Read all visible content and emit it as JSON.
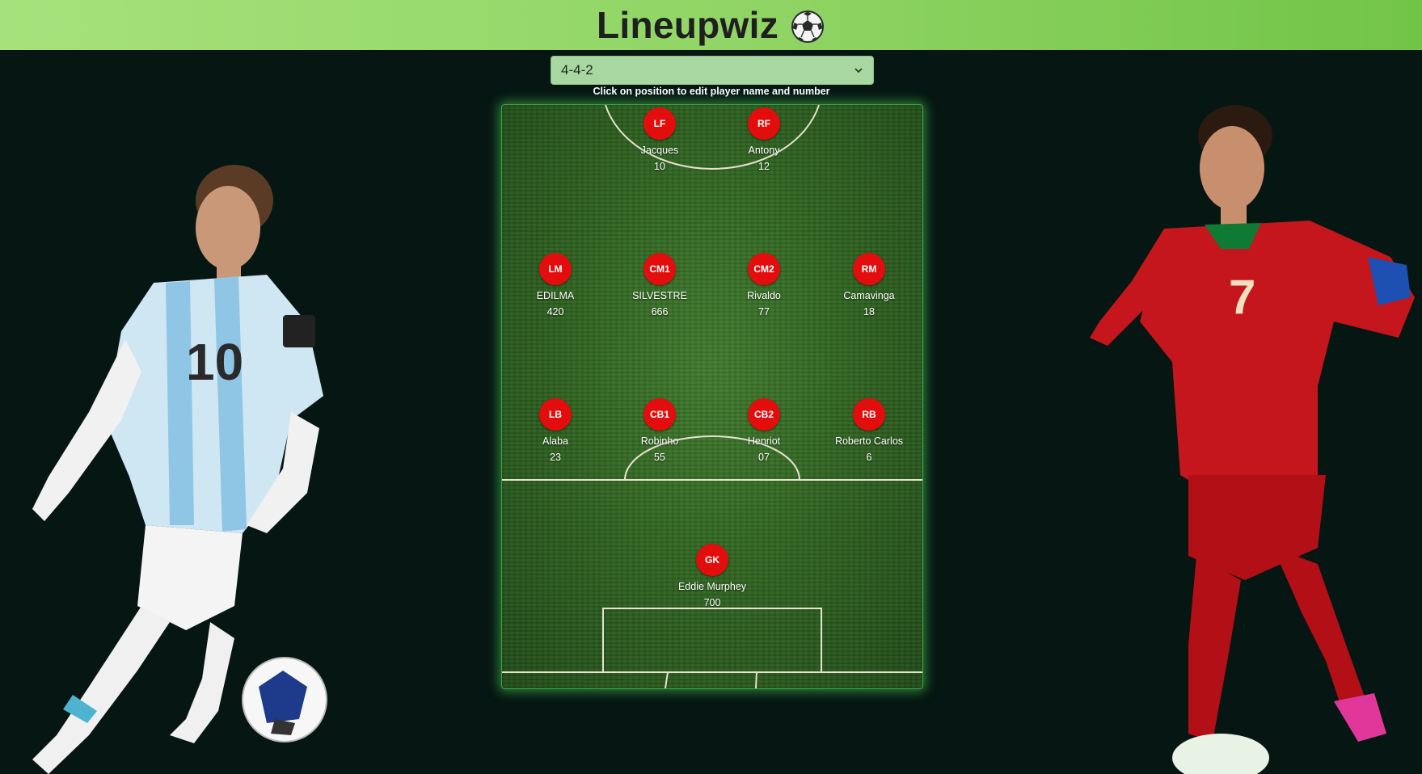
{
  "app": {
    "title": "Lineupwiz",
    "title_icon": "soccer-ball-icon"
  },
  "formation": {
    "selected": "4-4-2",
    "hint": "Click on position to edit player name and number"
  },
  "positions": [
    {
      "code": "LF",
      "name": "Jacques",
      "number": "10"
    },
    {
      "code": "RF",
      "name": "Antony",
      "number": "12"
    },
    {
      "code": "LM",
      "name": "EDILMA",
      "number": "420"
    },
    {
      "code": "CM1",
      "name": "SILVESTRE",
      "number": "666"
    },
    {
      "code": "CM2",
      "name": "Rivaldo",
      "number": "77"
    },
    {
      "code": "RM",
      "name": "Camavinga",
      "number": "18"
    },
    {
      "code": "LB",
      "name": "Alaba",
      "number": "23"
    },
    {
      "code": "CB1",
      "name": "Robinho",
      "number": "55"
    },
    {
      "code": "CB2",
      "name": "Henriot",
      "number": "07"
    },
    {
      "code": "RB",
      "name": "Roberto Carlos",
      "number": "6"
    },
    {
      "code": "GK",
      "name": "Eddie Murphey",
      "number": "700"
    }
  ],
  "colors": {
    "header_start": "#a6e27b",
    "header_end": "#72c447",
    "background": "#061612",
    "badge": "#e30d0d",
    "pitch_glow": "#50dc5a"
  }
}
